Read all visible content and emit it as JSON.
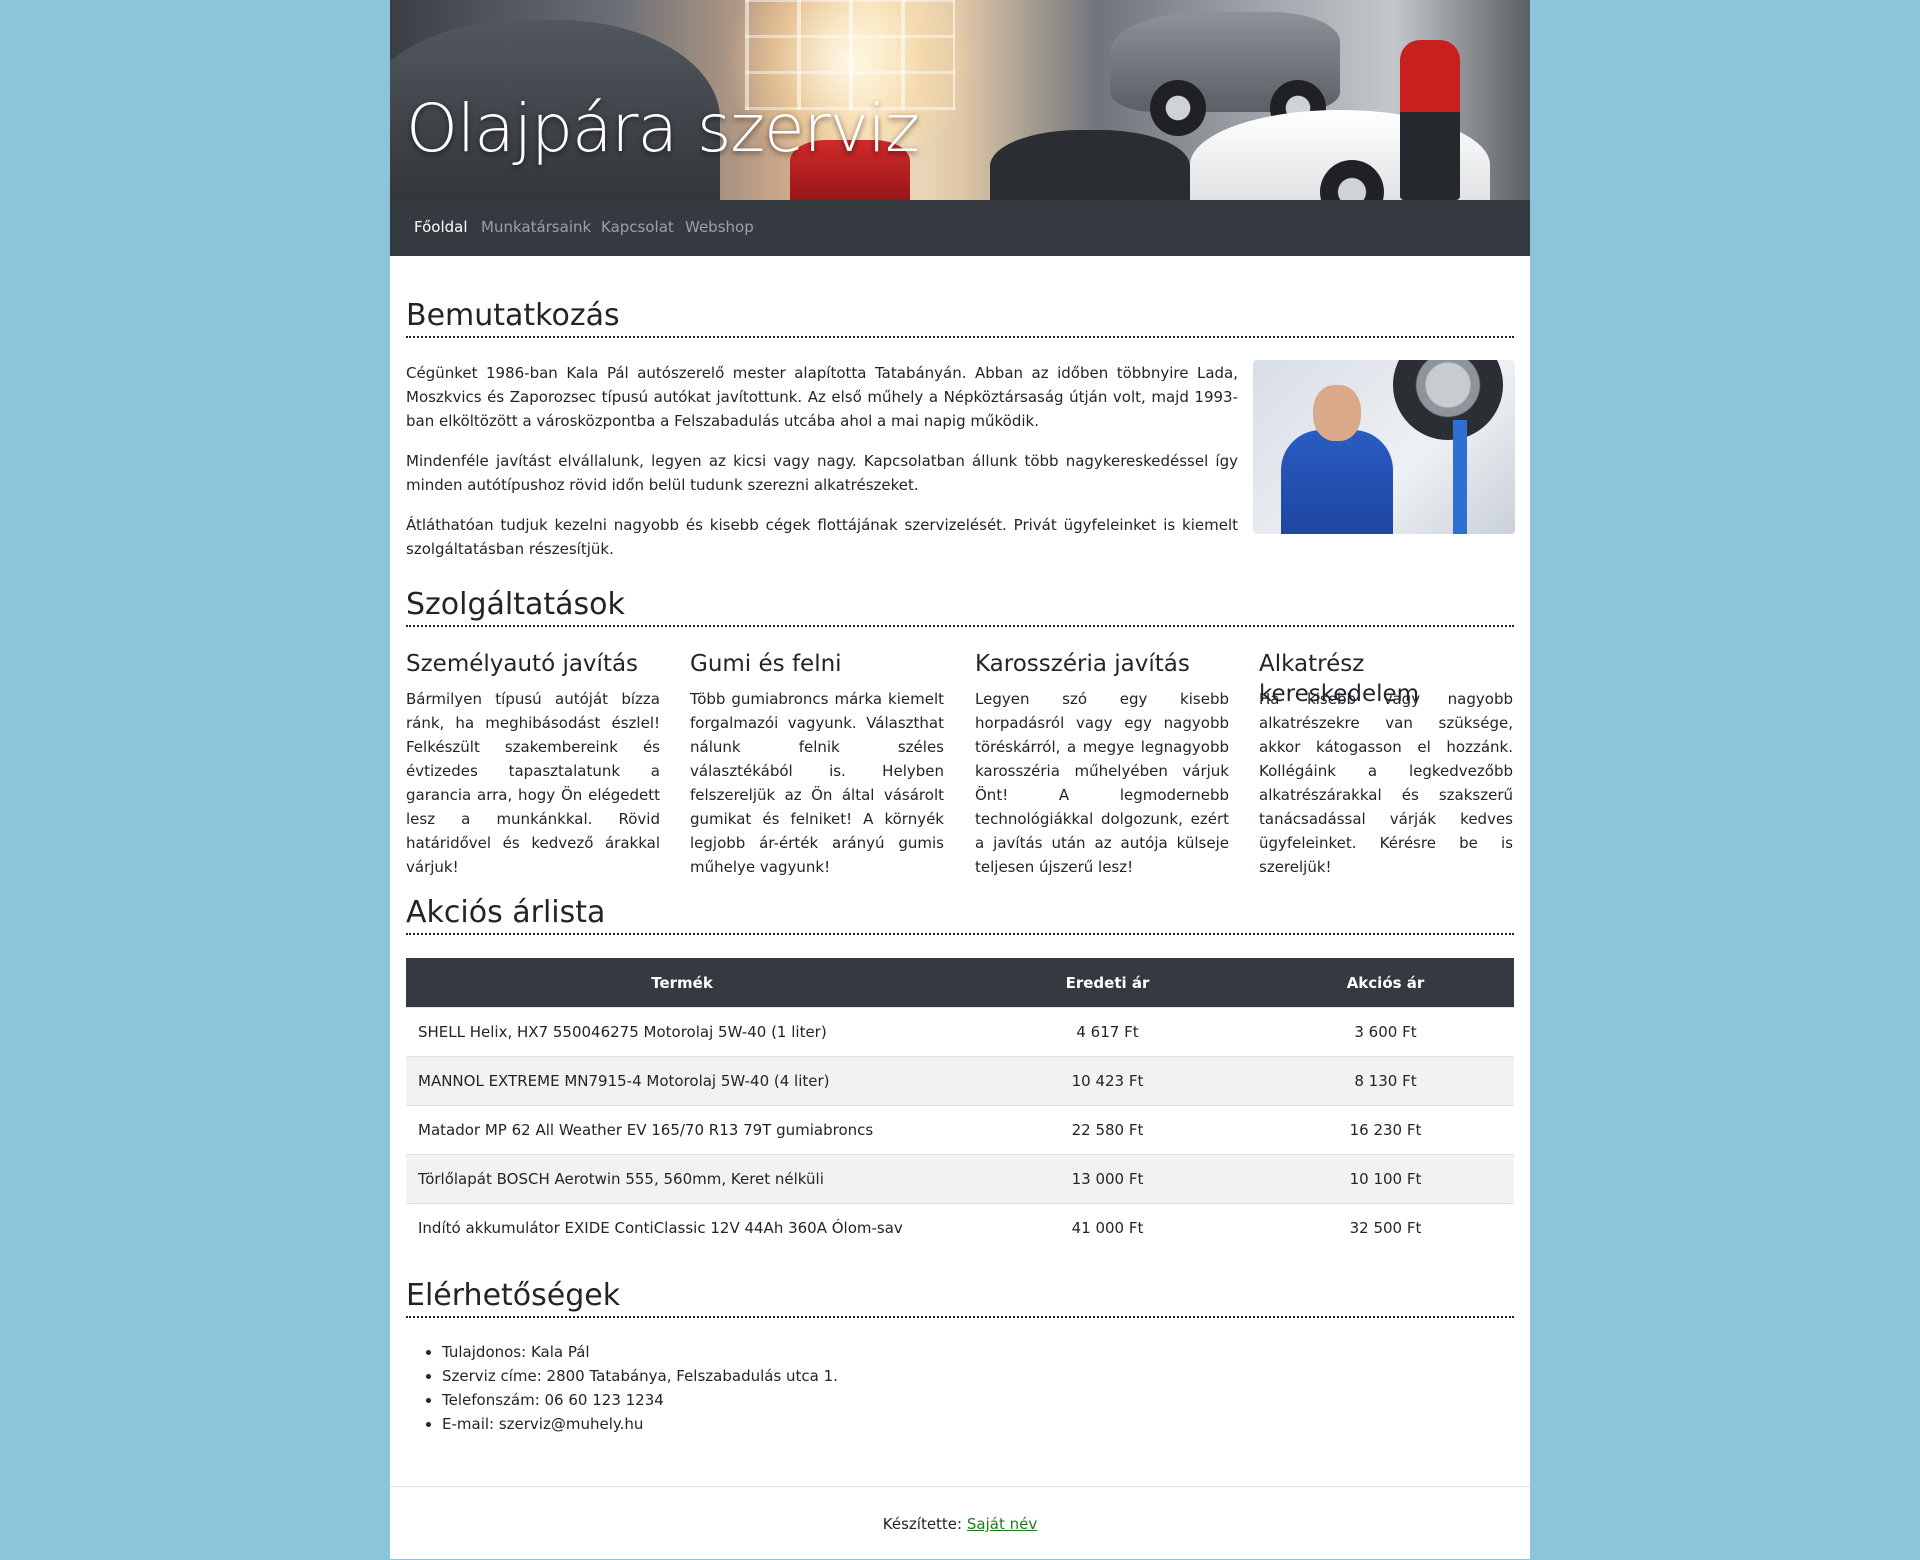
{
  "site": {
    "title": "Olajpára szerviz"
  },
  "nav": {
    "items": [
      {
        "label": "Főoldal",
        "active": true
      },
      {
        "label": "Munkatársaink",
        "active": false
      },
      {
        "label": "Kapcsolat",
        "active": false
      },
      {
        "label": "Webshop",
        "active": false
      }
    ]
  },
  "intro": {
    "heading": "Bemutatkozás",
    "paragraphs": [
      "Cégünket 1986-ban Kala Pál autószerelő mester alapította Tatabányán. Abban az időben többnyire Lada, Moszkvics és Zaporozsec típusú autókat javítottunk. Az első műhely a Népköztársaság útján volt, majd 1993-ban elköltözött a városközpontba a Felszabadulás utcába ahol a mai napig működik.",
      "Mindenféle javítást elvállalunk, legyen az kicsi vagy nagy. Kapcsolatban állunk több nagykereskedéssel így minden autótípushoz rövid időn belül tudunk szerezni alkatrészeket.",
      "Átláthatóan tudjuk kezelni nagyobb és kisebb cégek flottájának szervizelését. Privát ügyfeleinket is kiemelt szolgáltatásban részesítjük."
    ]
  },
  "services": {
    "heading": "Szolgáltatások",
    "items": [
      {
        "title": "Személyautó javítás",
        "text": "Bármilyen típusú autóját bízza ránk, ha meghibásodást észlel! Felkészült szakembereink és évtizedes tapasztalatunk a garancia arra, hogy Ön elégedett lesz a munkánkkal. Rövid határidővel és kedvező árakkal várjuk!"
      },
      {
        "title": "Gumi és felni",
        "text": "Több gumiabroncs márka kiemelt forgalmazói vagyunk. Választhat nálunk felnik széles választékából is. Helyben felszereljük az Ön által vásárolt gumikat és felniket! A környék legjobb ár-érték arányú gumis műhelye vagyunk!"
      },
      {
        "title": "Karosszéria javítás",
        "text": "Legyen szó egy kisebb horpadásról vagy egy nagyobb töréskárról, a megye legnagyobb karosszéria műhelyében várjuk Önt! A legmodernebb technológiákkal dolgozunk, ezért a javítás után az autója külseje teljesen újszerű lesz!"
      },
      {
        "title": "Alkatrész kereskedelem",
        "text": "Ha kisebb vagy nagyobb alkatrészekre van szüksége, akkor kátogasson el hozzánk. Kollégáink a legkedvezőbb alkatrészárakkal és szakszerű tanácsadással várják kedves ügyfeleinket. Kérésre be is szereljük!"
      }
    ]
  },
  "prices": {
    "heading": "Akciós árlista",
    "columns": [
      "Termék",
      "Eredeti ár",
      "Akciós ár"
    ],
    "rows": [
      [
        "SHELL Helix, HX7 550046275 Motorolaj 5W-40 (1 liter)",
        "4 617 Ft",
        "3 600 Ft"
      ],
      [
        "MANNOL EXTREME MN7915-4 Motorolaj 5W-40 (4 liter)",
        "10 423 Ft",
        "8 130 Ft"
      ],
      [
        "Matador MP 62 All Weather EV 165/70 R13 79T gumiabroncs",
        "22 580 Ft",
        "16 230 Ft"
      ],
      [
        "Törlőlapát BOSCH Aerotwin 555, 560mm, Keret nélküli",
        "13 000 Ft",
        "10 100 Ft"
      ],
      [
        "Indító akkumulátor EXIDE ContiClassic 12V 44Ah 360A Ólom-sav",
        "41 000 Ft",
        "32 500 Ft"
      ]
    ]
  },
  "contact": {
    "heading": "Elérhetőségek",
    "items": [
      "Tulajdonos: Kala Pál",
      "Szerviz címe: 2800 Tatabánya, Felszabadulás utca 1.",
      "Telefonszám: 06 60 123 1234",
      "E-mail: szerviz@muhely.hu"
    ]
  },
  "footer": {
    "prefix": "Készítette:",
    "link_label": "Saját név",
    "link_color": "#1a7f1a"
  },
  "colors": {
    "page_background": "#8cc4da",
    "navbar": "#343a40",
    "table_header": "#343a40"
  }
}
